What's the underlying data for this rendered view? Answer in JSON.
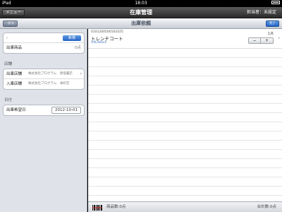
{
  "statusbar": {
    "carrier": "iPad",
    "wifi_icon": "wifi-icon",
    "time": "18:03",
    "battery_icon": "battery-icon"
  },
  "topbar": {
    "menu_label": "メニュー",
    "title": "在庫管理",
    "staff": "担当者：未設定"
  },
  "subbar": {
    "back_label": "戻る",
    "title": "出庫依頼",
    "done_label": "完了"
  },
  "left": {
    "row1_label": "-",
    "new_label": "新規",
    "goods_label": "出庫商品",
    "goods_value": "0点",
    "store_section": "店舗",
    "out_store_label": "出庫店舗",
    "out_store_value": "株式会社プログラム　原宿裏店",
    "in_store_label": "入庫店舗",
    "in_store_value": "株式会社プログラム　本町店",
    "date_section": "日付",
    "date_label": "出庫希望日",
    "date_value": "2012-10-01"
  },
  "items": [
    {
      "code": "0101200500101025",
      "name": "トレンチコート",
      "variant": "XXL/black",
      "qty": "1点"
    }
  ],
  "footer": {
    "barcode_icon": "barcode-icon",
    "goods_count": "商品数:0点",
    "total_count": "合計数:0点"
  },
  "colors": {
    "accent": "#2464c4",
    "topbar": "#2a2a2a",
    "sidebar_bg": "#dfe2e8"
  }
}
